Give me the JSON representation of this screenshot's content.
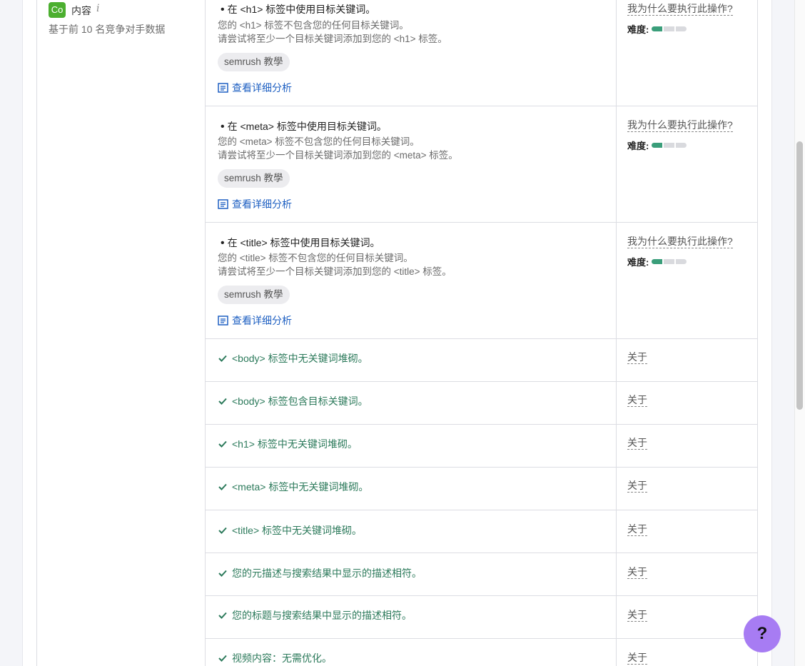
{
  "section": {
    "badge": "Co",
    "title": "内容",
    "info_glyph": "i",
    "subtitle": "基于前 10 名竞争对手数据"
  },
  "issues": [
    {
      "title": "在 <h1> 标签中使用目标关键词。",
      "desc1": "您的 <h1> 标签不包含您的任何目标关键词。",
      "desc2": "请尝试将至少一个目标关键词添加到您的 <h1> 标签。",
      "tag": "semrush 教學",
      "link": "查看详细分析",
      "why": "我为什么要执行此操作?",
      "difficulty_label": "难度:",
      "difficulty_level": 1,
      "difficulty_max": 3
    },
    {
      "title": "在 <meta> 标签中使用目标关键词。",
      "desc1": "您的 <meta> 标签不包含您的任何目标关键词。",
      "desc2": "请尝试将至少一个目标关键词添加到您的 <meta> 标签。",
      "tag": "semrush 教學",
      "link": "查看详细分析",
      "why": "我为什么要执行此操作?",
      "difficulty_label": "难度:",
      "difficulty_level": 1,
      "difficulty_max": 3
    },
    {
      "title": "在 <title> 标签中使用目标关键词。",
      "desc1": "您的 <title> 标签不包含您的任何目标关键词。",
      "desc2": "请尝试将至少一个目标关键词添加到您的 <title> 标签。",
      "tag": "semrush 教學",
      "link": "查看详细分析",
      "why": "我为什么要执行此操作?",
      "difficulty_label": "难度:",
      "difficulty_level": 1,
      "difficulty_max": 3
    }
  ],
  "passed": [
    {
      "text": "<body> 标签中无关键词堆砌。",
      "about": "关于"
    },
    {
      "text": "<body> 标签包含目标关键词。",
      "about": "关于"
    },
    {
      "text": "<h1> 标签中无关键词堆砌。",
      "about": "关于"
    },
    {
      "text": "<meta> 标签中无关键词堆砌。",
      "about": "关于"
    },
    {
      "text": "<title> 标签中无关键词堆砌。",
      "about": "关于"
    },
    {
      "text": "您的元描述与搜索结果中显示的描述相符。",
      "about": "关于"
    },
    {
      "text": "您的标题与搜索结果中显示的描述相符。",
      "about": "关于"
    },
    {
      "text": "视频内容：无需优化。",
      "about": "关于"
    }
  ],
  "help": {
    "label": "?"
  },
  "colors": {
    "accent_green": "#4caf2f",
    "check_green": "#2c7a5b",
    "link_blue": "#1d5fc2",
    "help_purple": "#a77cf3"
  }
}
